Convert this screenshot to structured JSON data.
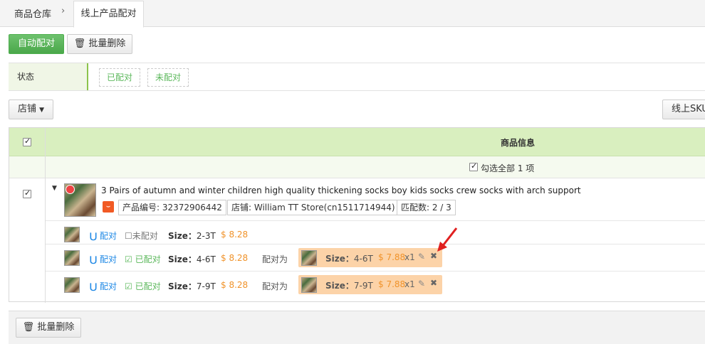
{
  "tabs": {
    "breadcrumb": "商品仓库",
    "active": "线上产品配对"
  },
  "toolbar": {
    "auto_pair": "自动配对",
    "batch_delete": "批量删除"
  },
  "filter": {
    "label": "状态",
    "options": [
      "已配对",
      "未配对"
    ]
  },
  "store_dropdown": "店铺",
  "sku_button": "线上SKU",
  "table": {
    "header": "商品信息",
    "select_all": "勾选全部 1 项"
  },
  "product": {
    "title": "3 Pairs of autumn and winter children high quality thickening socks boy kids socks crew socks with arch support",
    "product_no": "产品编号: 32372906442",
    "store": "店铺: William TT Store(cn1511714944)",
    "pair_count": "匹配数:  2 / 3"
  },
  "variants": [
    {
      "pair_label": "配对",
      "status": "未配对",
      "status_type": "unpaired",
      "size_label": "Size：",
      "size": "2-3T",
      "price": "$ 8.28"
    },
    {
      "pair_label": "配对",
      "status": "已配对",
      "status_type": "paired",
      "size_label": "Size：",
      "size": "4-6T",
      "price": "$ 8.28",
      "paired_as": "配对为",
      "paired": {
        "size_label": "Size：",
        "size": "4-6T",
        "price": "$ 7.88",
        "qty": "x1"
      }
    },
    {
      "pair_label": "配对",
      "status": "已配对",
      "status_type": "paired",
      "size_label": "Size：",
      "size": "7-9T",
      "price": "$ 8.28",
      "paired_as": "配对为",
      "paired": {
        "size_label": "Size：",
        "size": "7-9T",
        "price": "$ 7.88",
        "qty": "x1"
      }
    }
  ],
  "footer": {
    "batch_delete": "批量删除"
  }
}
